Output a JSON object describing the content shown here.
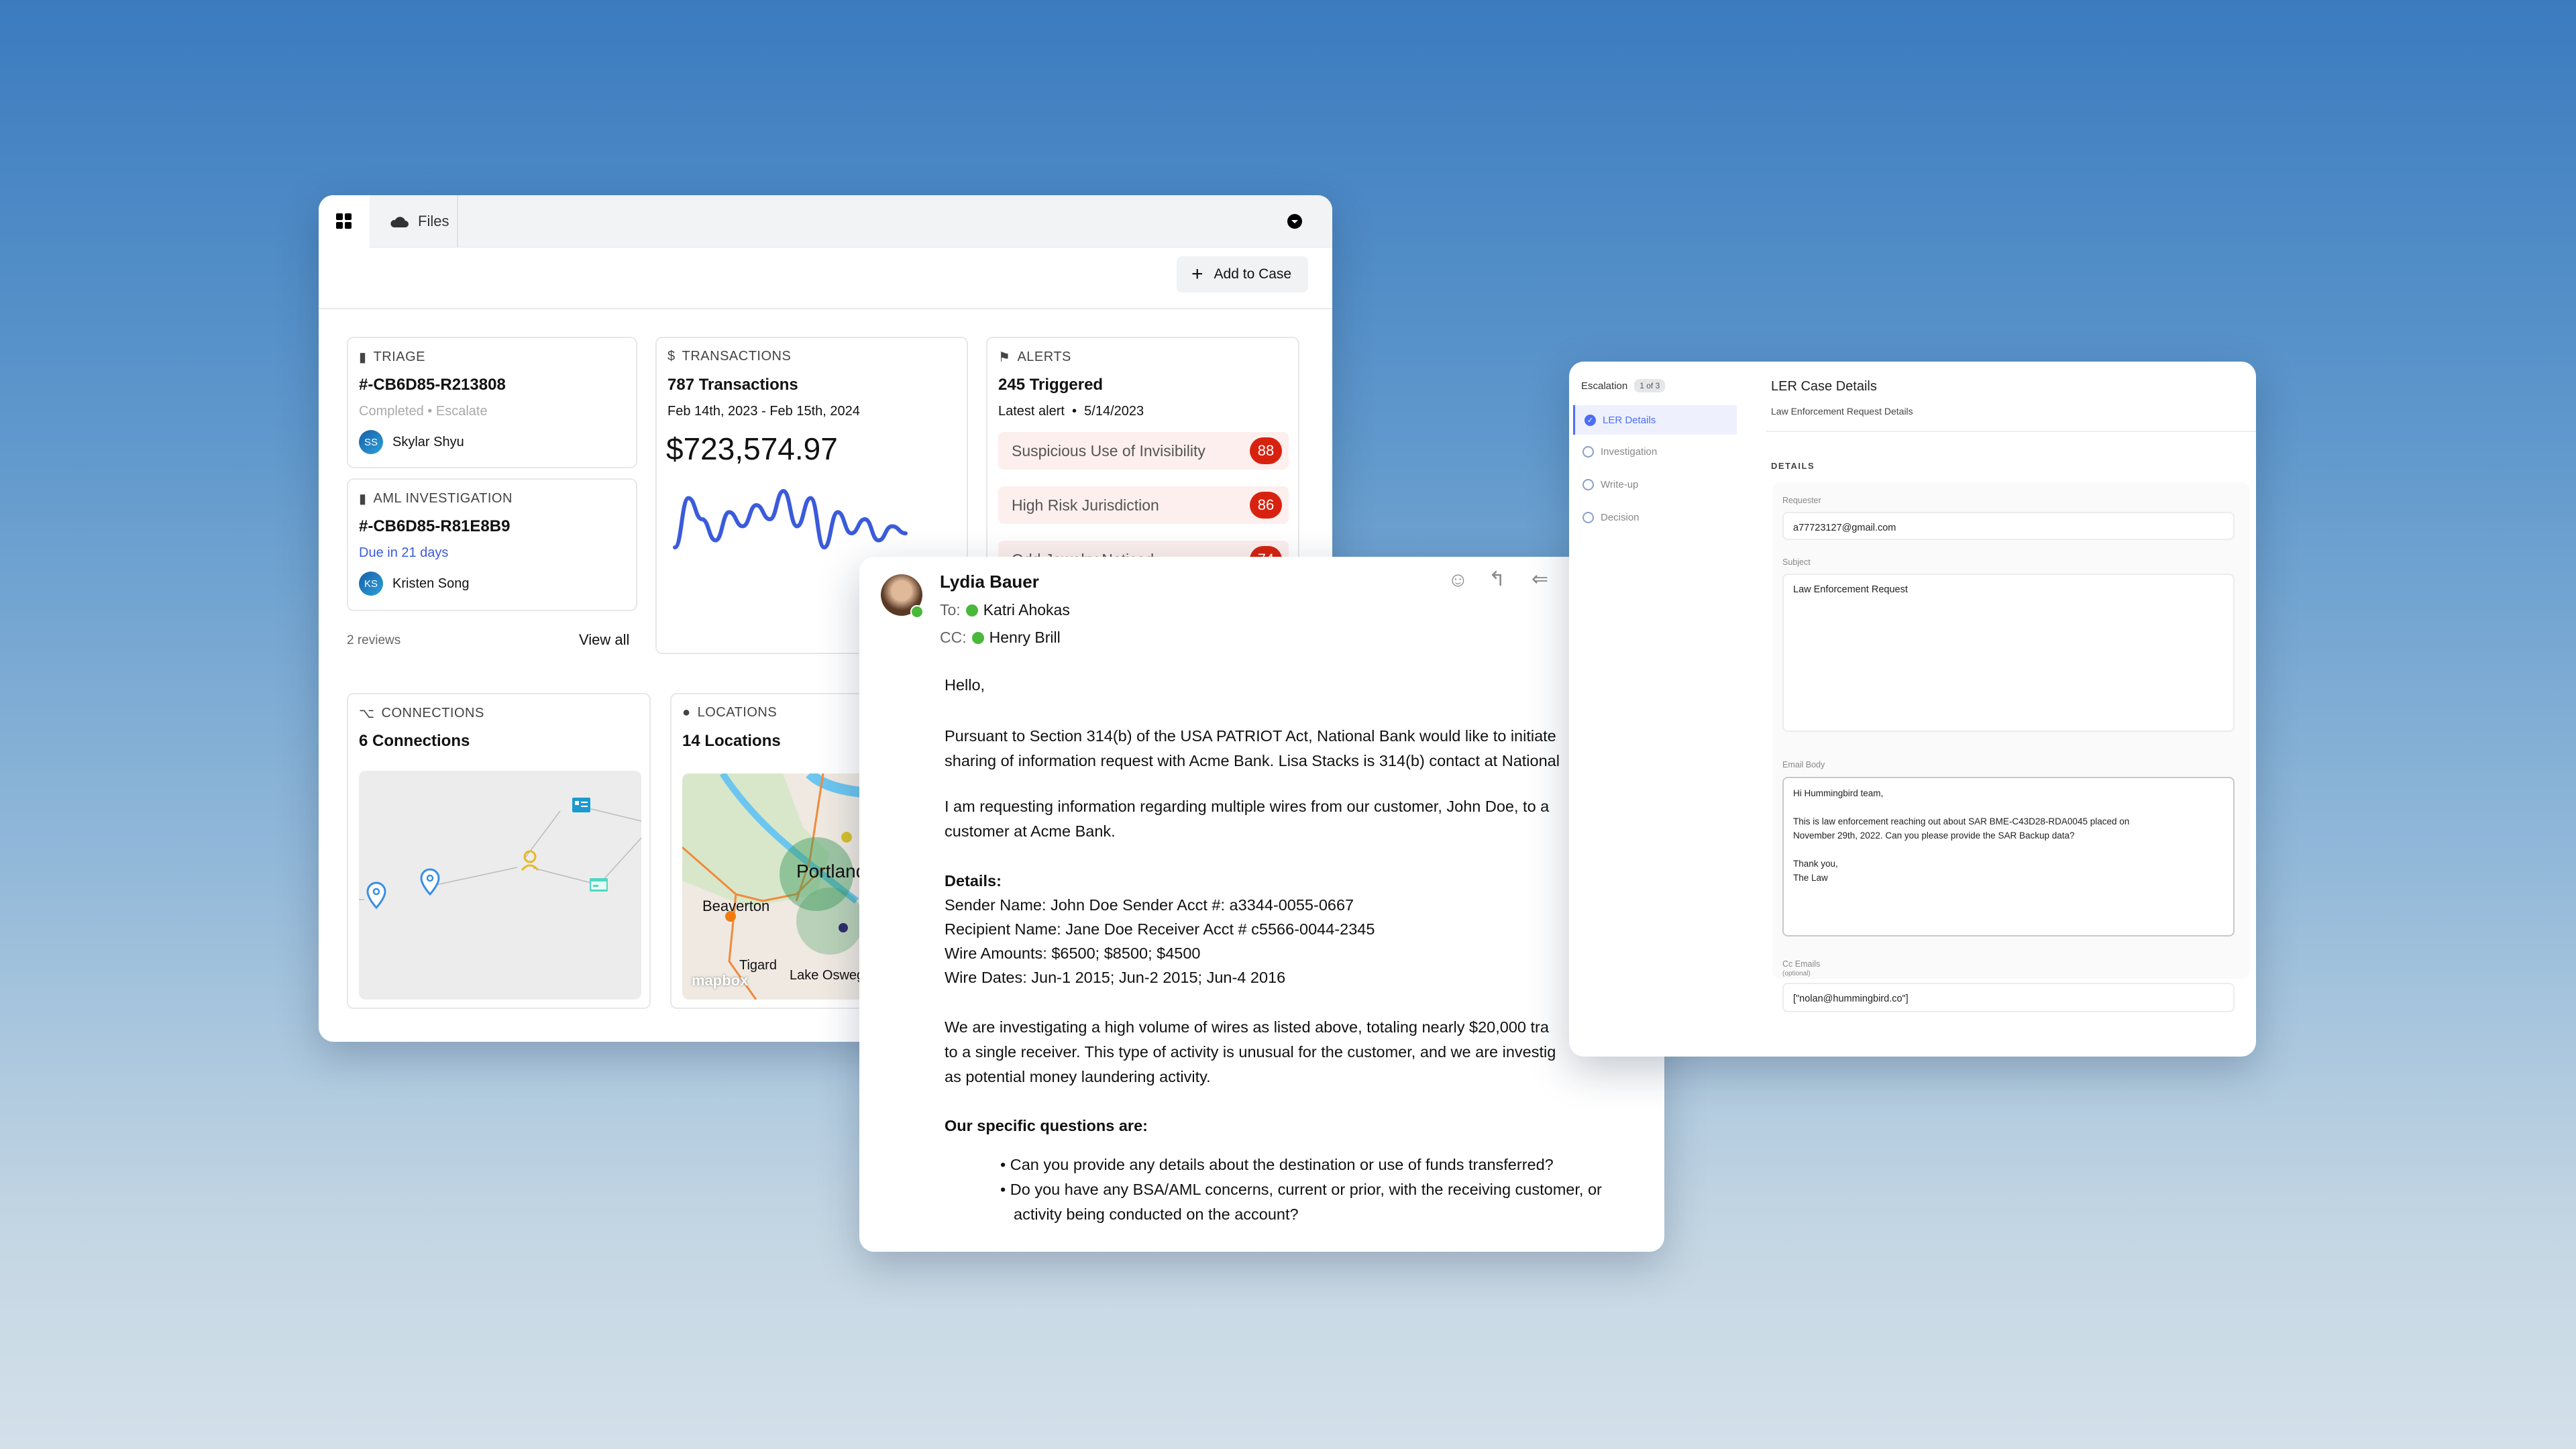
{
  "dashboard": {
    "tabs": [
      {
        "label": "Files",
        "icon": "cloud-icon"
      }
    ],
    "add_to_case": "Add to Case",
    "triage": {
      "header": "TRIAGE",
      "id": "#-CB6D85-R213808",
      "status": "Completed",
      "status_sep": "•",
      "status2": "Escalate",
      "assignee_initials": "SS",
      "assignee": "Skylar Shyu"
    },
    "aml": {
      "header": "AML INVESTIGATION",
      "id": "#-CB6D85-R81E8B9",
      "due": "Due in 21 days",
      "assignee_initials": "KS",
      "assignee": "Kristen Song"
    },
    "reviews": "2 reviews",
    "view_all": "View all",
    "transactions": {
      "header": "TRANSACTIONS",
      "count": "787 Transactions",
      "range": "Feb 14th, 2023 - Feb 15th, 2024",
      "total": "$723,574.97",
      "sparkline": [
        9,
        2,
        5,
        8,
        4,
        6,
        3,
        5,
        1,
        6,
        2,
        9,
        4,
        7,
        5,
        8,
        6,
        7
      ],
      "line_color": "#3b5bdb"
    },
    "alerts": {
      "header": "ALERTS",
      "count": "245 Triggered",
      "latest": "Latest alert  •  5/14/2023",
      "items": [
        {
          "label": "Suspicious Use of Invisibility",
          "score": "88"
        },
        {
          "label": "High Risk Jurisdiction",
          "score": "86"
        },
        {
          "label": "Odd Jewelry Noticed",
          "score": "74"
        }
      ]
    },
    "connections": {
      "header": "CONNECTIONS",
      "count": "6 Connections"
    },
    "locations": {
      "header": "LOCATIONS",
      "count": "14 Locations",
      "map_labels": [
        "Portland",
        "Beaverton",
        "Tigard",
        "Lake Oswego"
      ],
      "attribution": "mapbox"
    }
  },
  "email": {
    "sender": "Lydia Bauer",
    "to_label": "To:",
    "to": "Katri Ahokas",
    "cc_label": "CC:",
    "cc": "Henry Brill",
    "greeting": "Hello,",
    "p1": [
      "Pursuant to Section 314(b) of the USA PATRIOT Act, National Bank would like to initiate",
      "sharing of information request with Acme Bank. Lisa Stacks is 314(b) contact at National"
    ],
    "p2": [
      "I am requesting information regarding multiple wires from our customer, John Doe, to a",
      "customer at Acme Bank."
    ],
    "details_heading": "Details:",
    "details": [
      "Sender Name: John Doe Sender Acct #: a3344-0055-0667",
      "Recipient Name: Jane Doe Receiver Acct # c5566-0044-2345",
      "Wire Amounts: $6500; $8500; $4500",
      "Wire Dates: Jun-1 2015; Jun-2 2015; Jun-4 2016"
    ],
    "p3": [
      "We are investigating a high volume of wires as listed above, totaling nearly $20,000 tra",
      "to a single receiver. This type of activity is unusual for the customer, and we are investig",
      "as potential money laundering activity."
    ],
    "questions_heading": "Our specific questions are:",
    "questions": [
      "Can you provide any details about the destination or use of funds transferred?",
      "Do you have any BSA/AML concerns, current or prior, with the receiving customer, or",
      "activity being conducted on the account?"
    ]
  },
  "ler": {
    "escalation": "Escalation",
    "step_count": "1 of 3",
    "steps": [
      {
        "label": "LER Details",
        "state": "complete"
      },
      {
        "label": "Investigation",
        "state": "pending"
      },
      {
        "label": "Write-up",
        "state": "pending"
      },
      {
        "label": "Decision",
        "state": "pending"
      }
    ],
    "title": "LER Case Details",
    "subtitle": "Law Enforcement Request Details",
    "section": "DETAILS",
    "requester_label": "Requester",
    "requester": "a77723127@gmail.com",
    "subject_label": "Subject",
    "subject": "Law Enforcement Request",
    "body_label": "Email Body",
    "body": "Hi Hummingbird team,\n\nThis is law enforcement reaching out about SAR BME-C43D28-RDA0045 placed on\nNovember 29th, 2022. Can you please provide the SAR Backup data?\n\nThank you,\nThe Law",
    "cc_label": "Cc Emails",
    "cc_optional": "(optional)",
    "cc": "[\"nolan@hummingbird.co\"]",
    "accent": "#4c6ef5"
  }
}
